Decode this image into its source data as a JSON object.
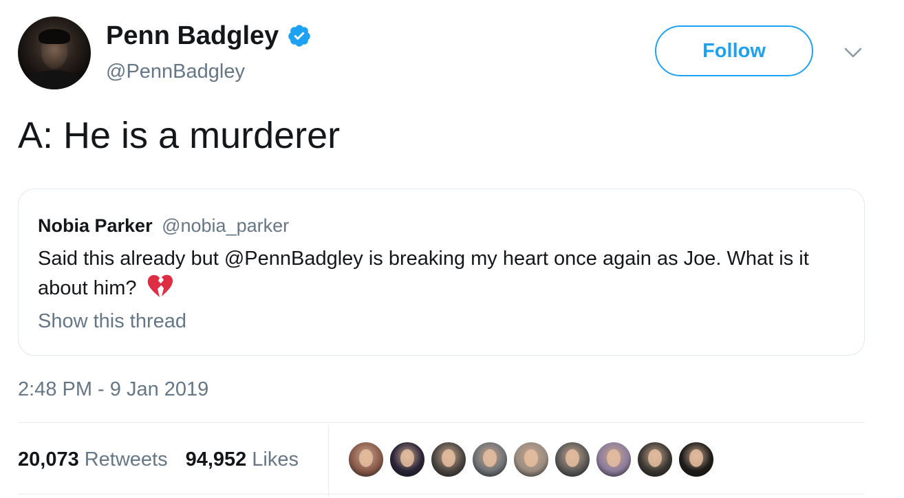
{
  "author": {
    "display_name": "Penn Badgley",
    "handle": "@PennBadgley",
    "verified": true,
    "avatar_icon": "profile-photo"
  },
  "actions": {
    "follow_label": "Follow",
    "more_icon": "chevron-down-icon"
  },
  "tweet": {
    "text": "A: He is a murderer",
    "timestamp": "2:48 PM - 9 Jan 2019"
  },
  "quoted_tweet": {
    "author_name": "Nobia Parker",
    "author_handle": "@nobia_parker",
    "text": "Said this already but @PennBadgley is breaking my heart once again as Joe. What is it about him?",
    "emoji": "broken-heart",
    "show_thread_label": "Show this thread"
  },
  "stats": {
    "retweets_count": "20,073",
    "retweets_label": "Retweets",
    "likes_count": "94,952",
    "likes_label": "Likes"
  },
  "likers": [
    {
      "name": "liker-avatar-1",
      "color": "#8a5a4a"
    },
    {
      "name": "liker-avatar-2",
      "color": "#2a2438"
    },
    {
      "name": "liker-avatar-3",
      "color": "#4a4540"
    },
    {
      "name": "liker-avatar-4",
      "color": "#6e7276"
    },
    {
      "name": "liker-avatar-5",
      "color": "#9a8c80"
    },
    {
      "name": "liker-avatar-6",
      "color": "#5c5a58"
    },
    {
      "name": "liker-avatar-7",
      "color": "#8c7c9c"
    },
    {
      "name": "liker-avatar-8",
      "color": "#3a3632"
    },
    {
      "name": "liker-avatar-9",
      "color": "#1e1c1a"
    }
  ],
  "colors": {
    "accent": "#1da1f2",
    "secondary_text": "#657786",
    "primary_text": "#14171a",
    "border": "#e1e8ed",
    "heart": "#e0245e"
  }
}
